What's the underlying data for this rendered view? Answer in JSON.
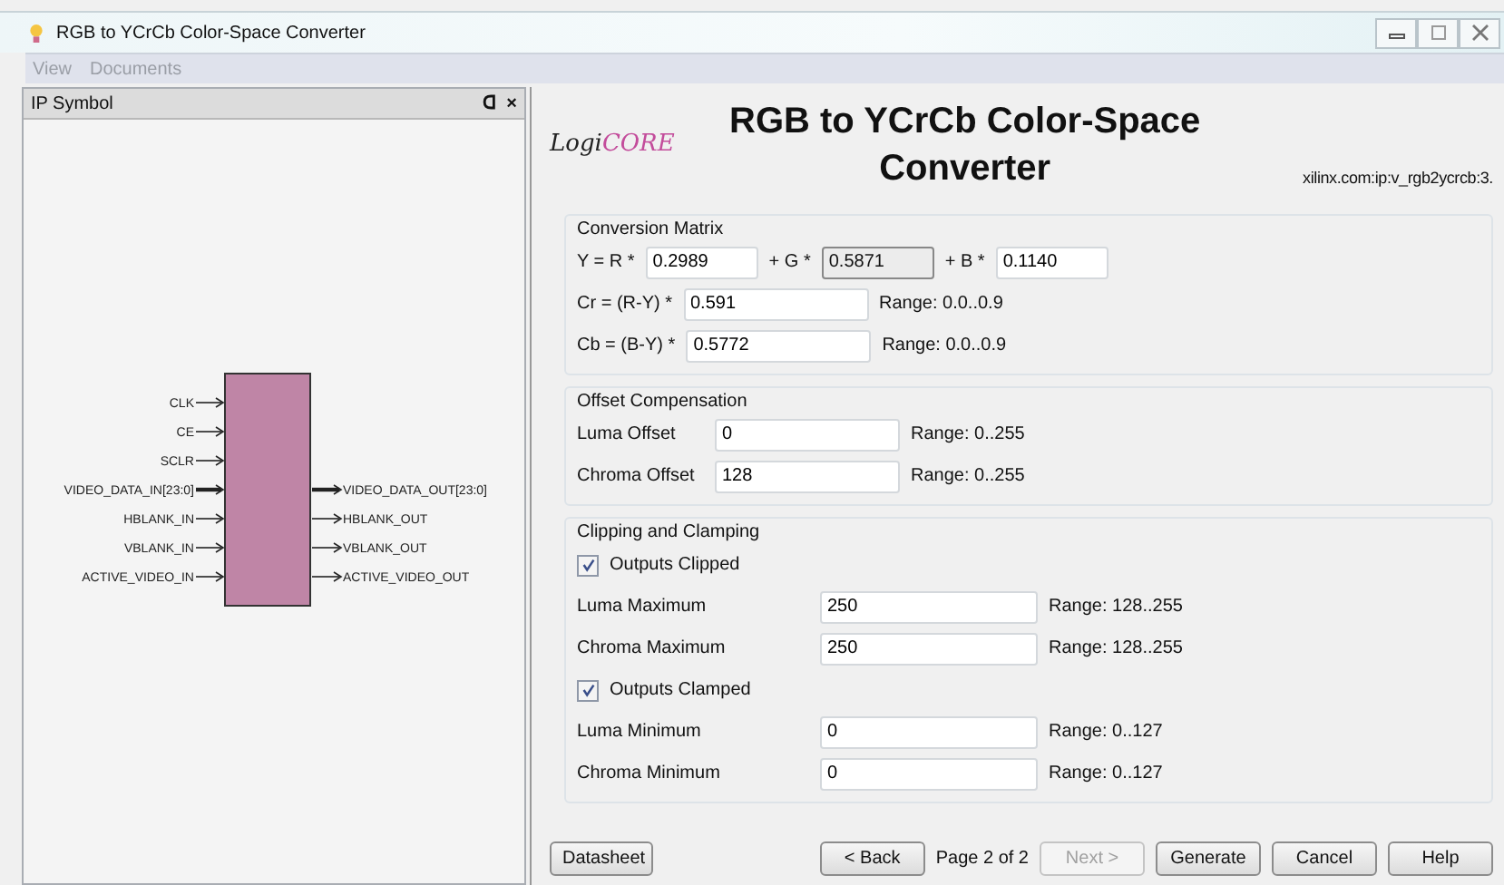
{
  "window": {
    "title": "RGB to YCrCb Color-Space Converter"
  },
  "menu": [
    {
      "label": "View",
      "disabled": true
    },
    {
      "label": "Documents",
      "disabled": true
    }
  ],
  "ip_symbol": {
    "title": "IP Symbol",
    "float_glyph": "ᗡ",
    "close_glyph": "×",
    "inputs": [
      {
        "name": "CLK",
        "bus": false
      },
      {
        "name": "CE",
        "bus": false
      },
      {
        "name": "SCLR",
        "bus": false
      },
      {
        "name": "VIDEO_DATA_IN[23:0]",
        "bus": true
      },
      {
        "name": "HBLANK_IN",
        "bus": false
      },
      {
        "name": "VBLANK_IN",
        "bus": false
      },
      {
        "name": "ACTIVE_VIDEO_IN",
        "bus": false
      }
    ],
    "outputs": [
      {
        "name": "VIDEO_DATA_OUT[23:0]",
        "bus": true
      },
      {
        "name": "HBLANK_OUT",
        "bus": false
      },
      {
        "name": "VBLANK_OUT",
        "bus": false
      },
      {
        "name": "ACTIVE_VIDEO_OUT",
        "bus": false
      }
    ]
  },
  "header": {
    "logo_left": "Logi",
    "logo_right": "CORE",
    "title": "RGB to YCrCb Color-Space Converter",
    "vlnv": "xilinx.com:ip:v_rgb2ycrcb:3."
  },
  "sections": [
    {
      "title": "Conversion Matrix",
      "rows": [
        {
          "kind": "terms",
          "terms": [
            {
              "label": "Y = R *",
              "value": "0.2989",
              "disabled": false
            },
            {
              "label": "+ G *",
              "value": "0.5871",
              "disabled": true
            },
            {
              "label": "+ B *",
              "value": "0.1140",
              "disabled": false
            }
          ]
        },
        {
          "kind": "field",
          "label": "Cr = (R-Y) *",
          "value": "0.591",
          "range": "Range: 0.0..0.9"
        },
        {
          "kind": "field",
          "label": "Cb = (B-Y) *",
          "value": "0.5772",
          "range": "Range: 0.0..0.9"
        }
      ]
    },
    {
      "title": "Offset Compensation",
      "rows": [
        {
          "kind": "field",
          "label": "Luma Offset",
          "value": "0",
          "range": "Range: 0..255"
        },
        {
          "kind": "field",
          "label": "Chroma Offset",
          "value": "128",
          "range": "Range: 0..255"
        }
      ]
    },
    {
      "title": "Clipping and Clamping",
      "rows": [
        {
          "kind": "checkbox",
          "label": "Outputs Clipped",
          "checked": true
        },
        {
          "kind": "field",
          "label": "Luma Maximum",
          "value": "250",
          "range": "Range: 128..255"
        },
        {
          "kind": "field",
          "label": "Chroma Maximum",
          "value": "250",
          "range": "Range: 128..255"
        },
        {
          "kind": "checkbox",
          "label": "Outputs Clamped",
          "checked": true
        },
        {
          "kind": "field",
          "label": "Luma Minimum",
          "value": "0",
          "range": "Range: 0..127"
        },
        {
          "kind": "field",
          "label": "Chroma Minimum",
          "value": "0",
          "range": "Range: 0..127"
        }
      ]
    }
  ],
  "footer": {
    "datasheet": "Datasheet",
    "back": {
      "label": "< Back",
      "disabled": false
    },
    "page": "Page 2 of 2",
    "next": {
      "label": "Next >",
      "disabled": true
    },
    "buttons": [
      "Generate",
      "Cancel",
      "Help"
    ]
  }
}
